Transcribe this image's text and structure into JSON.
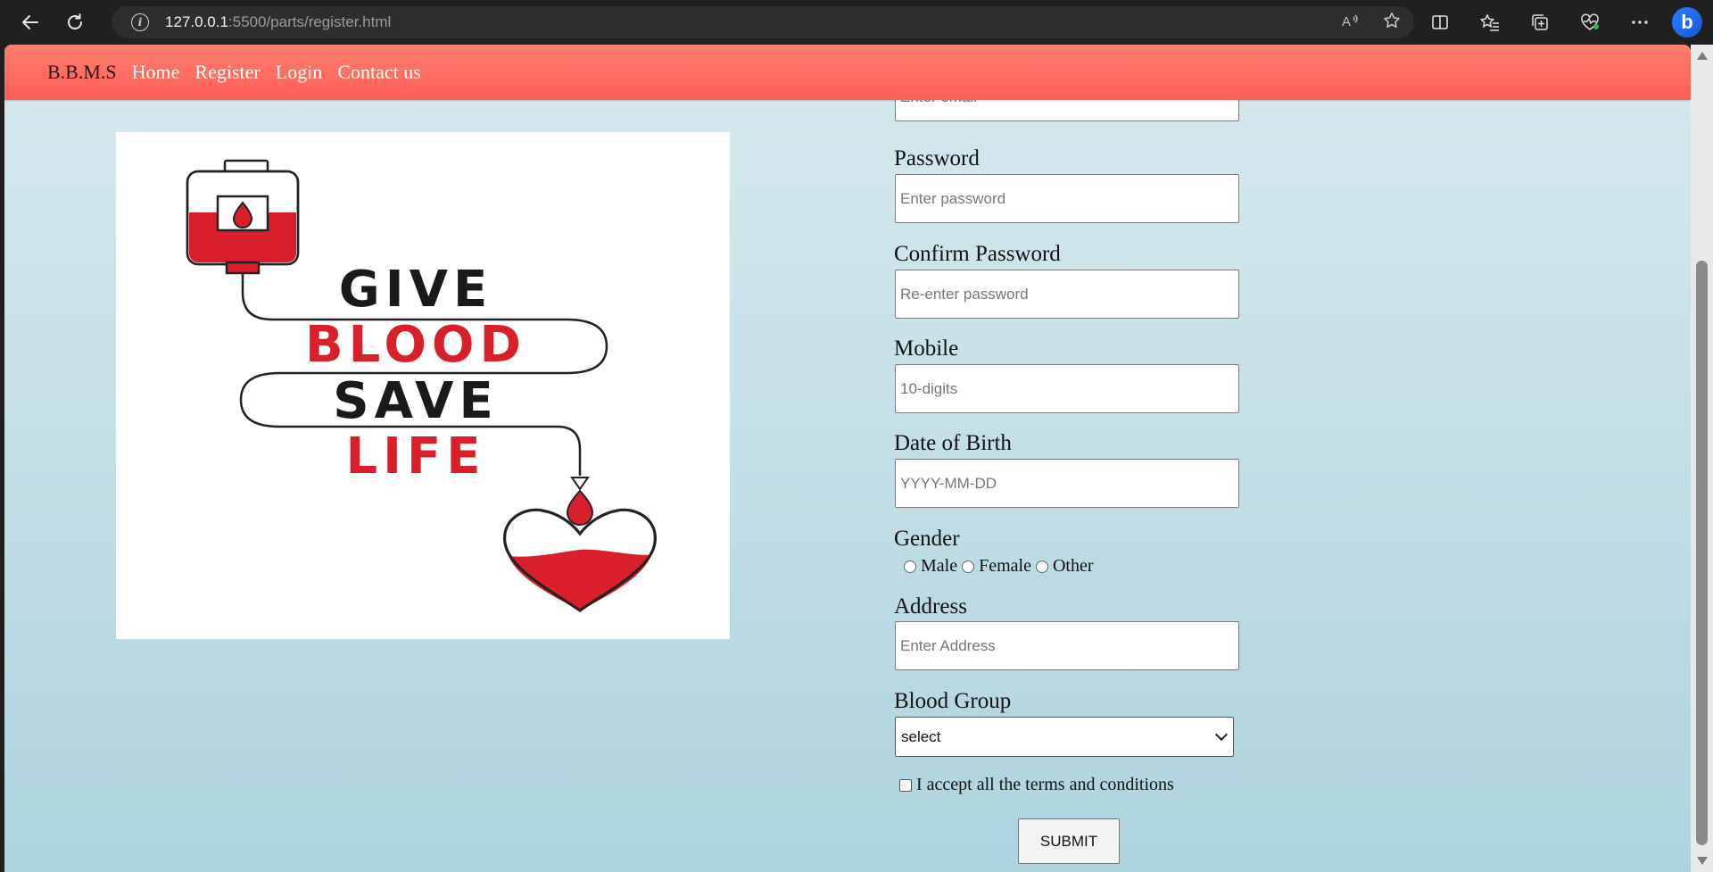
{
  "browser": {
    "url_host": "127.0.0.1",
    "url_rest": ":5500/parts/register.html"
  },
  "navbar": {
    "brand": "B.B.M.S",
    "links": [
      "Home",
      "Register",
      "Login",
      "Contact us"
    ]
  },
  "form": {
    "email_placeholder": "Enter email",
    "password_label": "Password",
    "password_placeholder": "Enter password",
    "confirm_label": "Confirm Password",
    "confirm_placeholder": "Re-enter password",
    "mobile_label": "Mobile",
    "mobile_placeholder": "10-digits",
    "dob_label": "Date of Birth",
    "dob_placeholder": "YYYY-MM-DD",
    "gender_label": "Gender",
    "gender_options": [
      "Male",
      "Female",
      "Other"
    ],
    "address_label": "Address",
    "address_placeholder": "Enter Address",
    "blood_label": "Blood Group",
    "blood_selected": "select",
    "terms_label": "I accept all the terms and conditions",
    "submit_label": "SUBMIT"
  },
  "poster": {
    "line1": "GIVE",
    "line2": "BLOOD",
    "line3": "SAVE",
    "line4": "LIFE"
  },
  "colors": {
    "navbar": "#ff6a5e",
    "blood_red": "#d9202a"
  }
}
